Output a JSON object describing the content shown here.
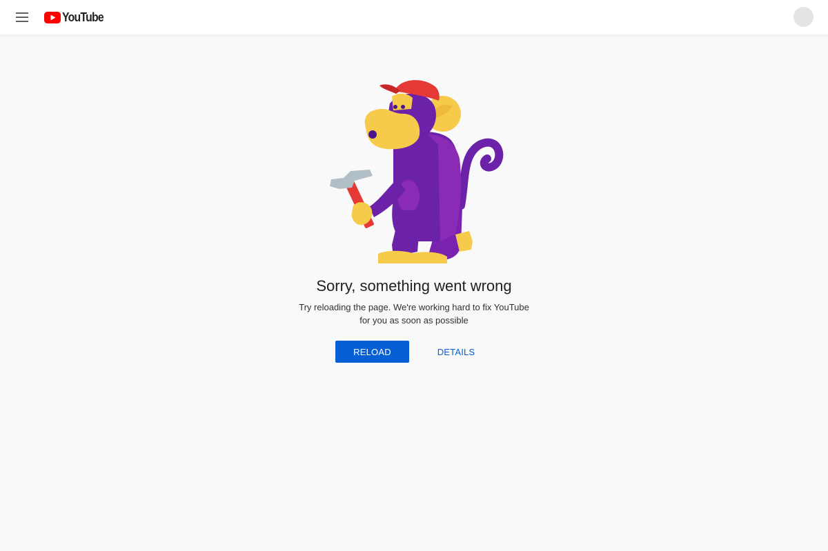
{
  "header": {
    "logo_text": "YouTube",
    "brand_color": "#ff0000"
  },
  "error": {
    "title": "Sorry, something went wrong",
    "message_line1": "Try reloading the page. We're working hard to fix YouTube",
    "message_line2": "for you as soon as possible"
  },
  "actions": {
    "reload_label": "RELOAD",
    "details_label": "DETAILS",
    "accent_color": "#065fd4"
  },
  "icons": {
    "menu": "hamburger-menu-icon",
    "logo": "youtube-play-icon",
    "avatar": "account-avatar"
  },
  "illustration": {
    "subject": "monkey-with-hammer",
    "colors": {
      "body": "#6b22a8",
      "body_light": "#8a2bb5",
      "face": "#f6cb4b",
      "hat": "#e53935",
      "hammer_head": "#b0bec5",
      "hammer_handle": "#e53935"
    }
  }
}
